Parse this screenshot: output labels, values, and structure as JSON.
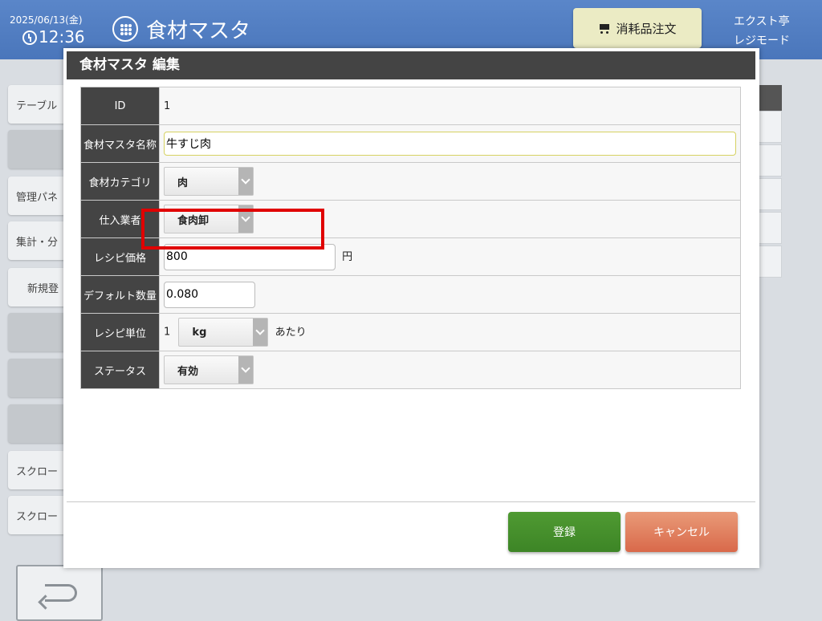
{
  "header": {
    "date": "2025/06/13(金)",
    "time": "12:36",
    "app_title": "食材マスタ",
    "order_button": "消耗品注文",
    "store_name": "エクスト亭",
    "mode": "レジモード"
  },
  "side_menu": [
    "テーブル",
    "",
    "管理パネ",
    "集計・分",
    "新規登",
    "",
    "",
    "",
    "スクロー",
    "スクロー"
  ],
  "modal": {
    "title": "食材マスタ 編集",
    "fields": {
      "id": {
        "label": "ID",
        "value": "1"
      },
      "name": {
        "label": "食材マスタ名称",
        "value": "牛すじ肉"
      },
      "category": {
        "label": "食材カテゴリ",
        "value": "肉"
      },
      "supplier": {
        "label": "仕入業者",
        "value": "食肉卸"
      },
      "recipe_price": {
        "label": "レシピ価格",
        "value": "800",
        "unit": "円"
      },
      "default_qty": {
        "label": "デフォルト数量",
        "value": "0.080"
      },
      "recipe_unit": {
        "label": "レシピ単位",
        "prefix": "1",
        "value": "kg",
        "suffix": "あたり"
      },
      "status": {
        "label": "ステータス",
        "value": "有効"
      }
    },
    "register_button": "登録",
    "cancel_button": "キャンセル"
  },
  "colors": {
    "header": "#4a76bb",
    "register": "#3d8526",
    "cancel": "#d9694a",
    "highlight": "#e00000"
  }
}
